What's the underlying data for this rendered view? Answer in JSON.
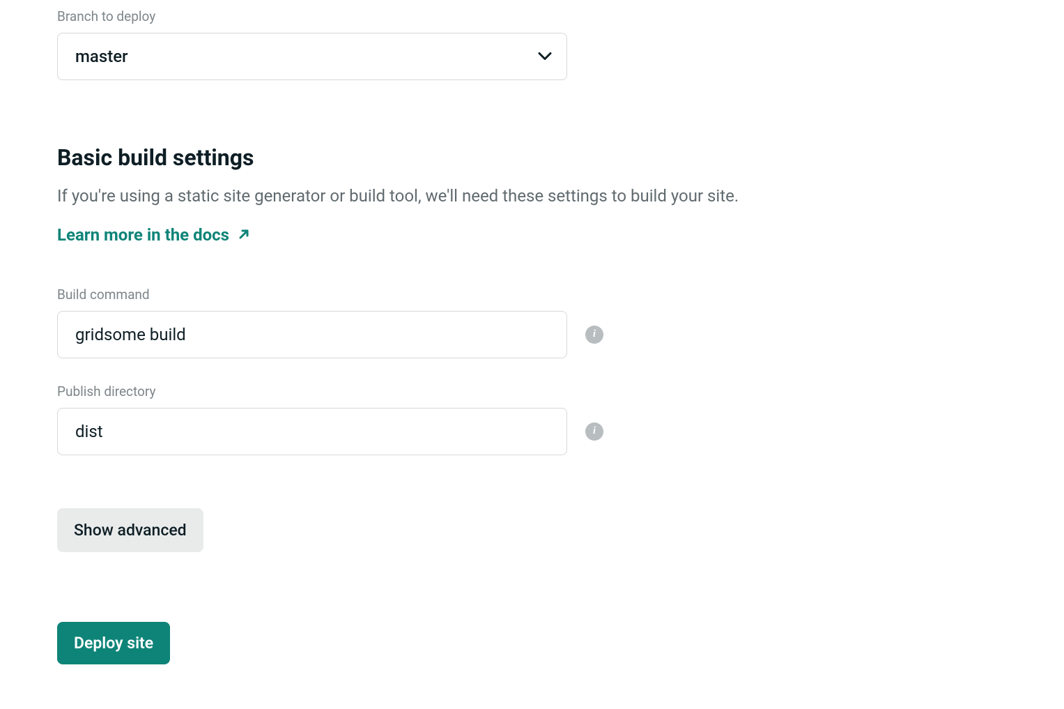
{
  "branch": {
    "label": "Branch to deploy",
    "value": "master"
  },
  "build_settings": {
    "heading": "Basic build settings",
    "description": "If you're using a static site generator or build tool, we'll need these settings to build your site.",
    "docs_link": "Learn more in the docs"
  },
  "build_command": {
    "label": "Build command",
    "value": "gridsome build"
  },
  "publish_directory": {
    "label": "Publish directory",
    "value": "dist"
  },
  "buttons": {
    "show_advanced": "Show advanced",
    "deploy": "Deploy site"
  },
  "info_glyph": "i"
}
